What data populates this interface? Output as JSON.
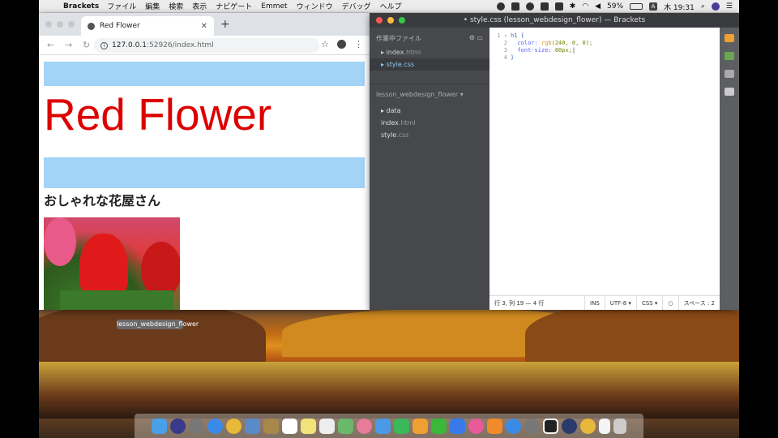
{
  "menubar": {
    "app_name": "Brackets",
    "menus": [
      "ファイル",
      "編集",
      "検索",
      "表示",
      "ナビゲート",
      "Emmet",
      "ウィンドウ",
      "デバッグ",
      "ヘルプ"
    ],
    "battery": "59%",
    "clock": "木 19:31",
    "input_badge": "A"
  },
  "chrome": {
    "tab_title": "Red Flower",
    "url_host": "127.0.0.1",
    "url_path": ":52926/index.html",
    "page": {
      "heading": "Red Flower",
      "subheading": "おしゃれな花屋さん"
    }
  },
  "desktop": {
    "folder_label": "lesson_webdesign_flower"
  },
  "brackets": {
    "window_title": "• style.css (lesson_webdesign_flower) — Brackets",
    "working_files_label": "作業中ファイル",
    "working_files": [
      {
        "name": "index",
        "ext": ".html"
      },
      {
        "name": "style",
        "ext": ".css"
      }
    ],
    "project_name": "lesson_webdesign_flower ▾",
    "tree": [
      {
        "name": "▸ data",
        "ext": ""
      },
      {
        "name": "index",
        "ext": ".html"
      },
      {
        "name": "style",
        "ext": ".css"
      }
    ],
    "code": {
      "l1": "h1 {",
      "l2_prop": "color:",
      "l2_fn": "rgb",
      "l2_args": "(240, 0, 0);",
      "l3_prop": "font-size:",
      "l3_val": "80px;",
      "l4": "}"
    },
    "status": {
      "position": "行 3, 列 19 — 4 行",
      "ins": "INS",
      "encoding": "UTF-8 ▾",
      "language": "CSS ▾",
      "spaces": "スペース : 2"
    }
  }
}
